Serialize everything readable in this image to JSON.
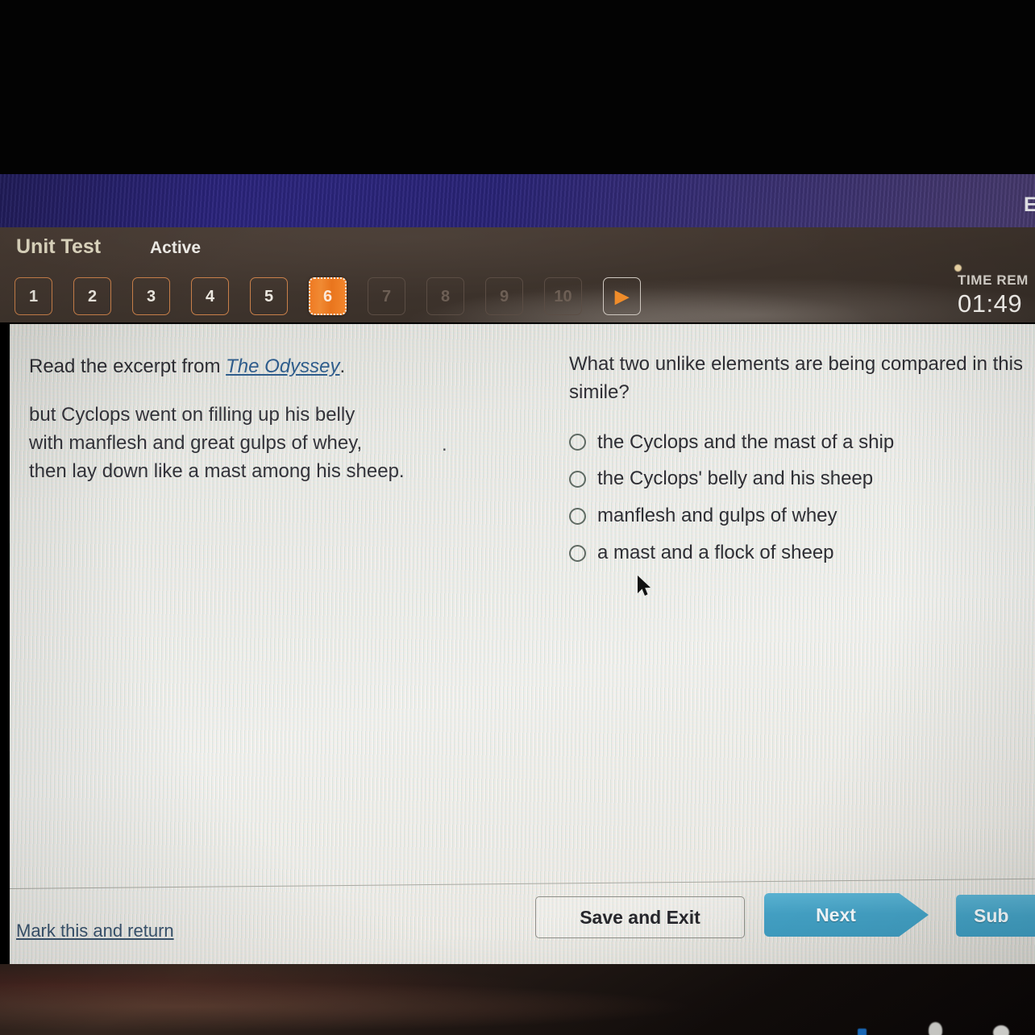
{
  "brand": {
    "title_visible": "E"
  },
  "toolbar": {
    "title": "Unit Test",
    "status": "Active",
    "questions": [
      {
        "label": "1",
        "state": "available"
      },
      {
        "label": "2",
        "state": "available"
      },
      {
        "label": "3",
        "state": "available"
      },
      {
        "label": "4",
        "state": "available"
      },
      {
        "label": "5",
        "state": "available"
      },
      {
        "label": "6",
        "state": "active"
      },
      {
        "label": "7",
        "state": "disabled"
      },
      {
        "label": "8",
        "state": "disabled"
      },
      {
        "label": "9",
        "state": "disabled"
      },
      {
        "label": "10",
        "state": "disabled"
      }
    ],
    "next_arrow_glyph": "▶",
    "timer_label": "TIME REM",
    "timer_value": "01:49"
  },
  "excerpt": {
    "lead_before": "Read the excerpt from ",
    "lead_link": "The Odyssey",
    "lead_after": ".",
    "lines": [
      "but Cyclops went on filling up his belly",
      "with manflesh and great gulps of whey,",
      "then lay down like a mast among his sheep."
    ],
    "trailing_mark": "."
  },
  "question": {
    "prompt": "What two unlike elements are being compared in this simile?",
    "options": [
      {
        "label": "the Cyclops and the mast of a ship",
        "selected": false
      },
      {
        "label": "the Cyclops' belly and his sheep",
        "selected": false
      },
      {
        "label": "manflesh and gulps of whey",
        "selected": false
      },
      {
        "label": "a mast and a flock of sheep",
        "selected": false
      }
    ]
  },
  "footer": {
    "mark_link": "Mark this and return",
    "save_exit": "Save and Exit",
    "next": "Next",
    "submit": "Sub"
  },
  "colors": {
    "brand_purple": "#2c2580",
    "toolbar_brown": "#443830",
    "active_orange": "#ef7a23",
    "button_blue": "#45a3c6",
    "link_blue": "#2f5d8c"
  }
}
